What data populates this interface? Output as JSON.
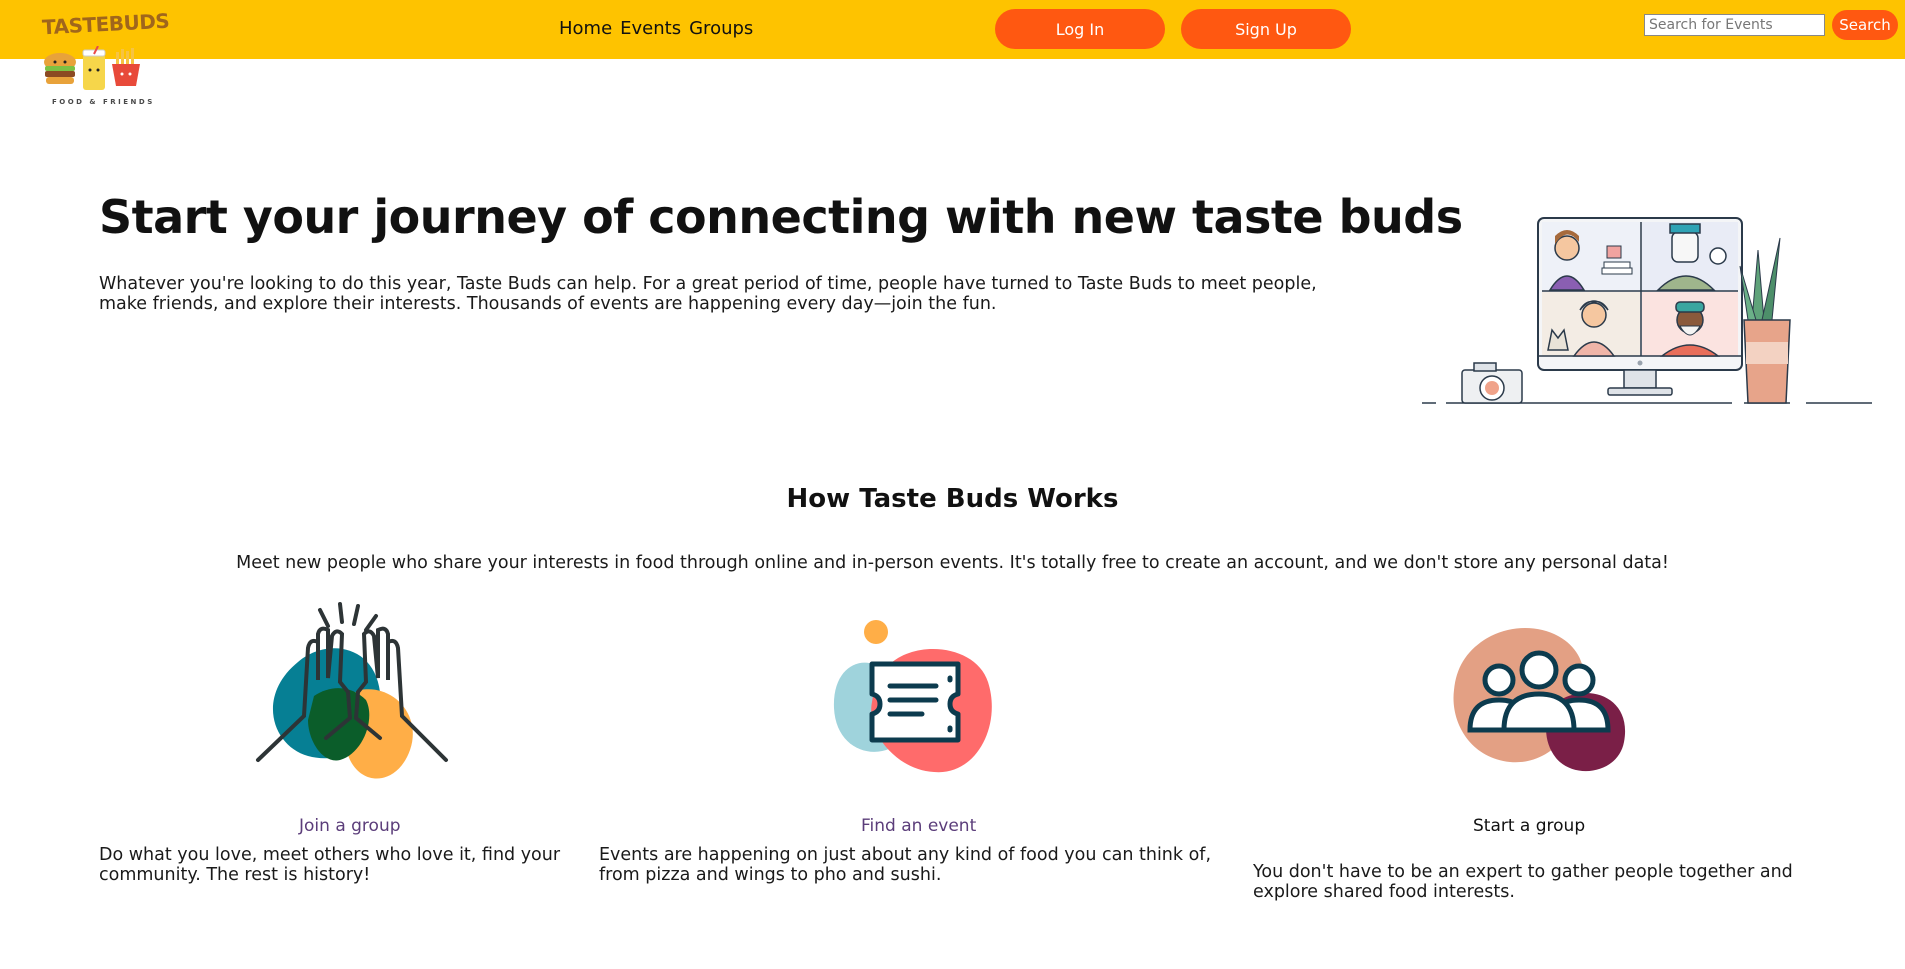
{
  "header": {
    "logo_text": "TASTEBUDS",
    "logo_tagline": "FOOD & FRIENDS",
    "nav": [
      {
        "label": "Home"
      },
      {
        "label": "Events"
      },
      {
        "label": "Groups"
      }
    ],
    "login_label": "Log In",
    "signup_label": "Sign Up",
    "search_placeholder": "Search for Events",
    "search_button_label": "Search"
  },
  "hero": {
    "title": "Start your journey of connecting with new taste buds",
    "text": "Whatever you're looking to do this year, Taste Buds can help. For a great period of time, people have turned to Taste Buds to meet people, make friends, and explore their interests. Thousands of events are happening every day—join the fun."
  },
  "how": {
    "title": "How Taste Buds Works",
    "subtitle": "Meet new people who share your interests in food through online and in-person events. It's totally free to create an account, and we don't store any personal data!",
    "features": [
      {
        "label": "Join a group",
        "text": "Do what you love, meet others who love it, find your community. The rest is history!",
        "icon": "high-five-icon"
      },
      {
        "label": "Find an event",
        "text": "Events are happening on just about any kind of food you can think of, from pizza and wings to pho and sushi.",
        "icon": "ticket-icon"
      },
      {
        "label": "Start a group",
        "text": "You don't have to be an expert to gather people together and explore shared food interests.",
        "icon": "people-group-icon"
      }
    ]
  },
  "colors": {
    "header_bg": "#fec300",
    "accent": "#ff5811",
    "link": "#5b3d7a"
  }
}
